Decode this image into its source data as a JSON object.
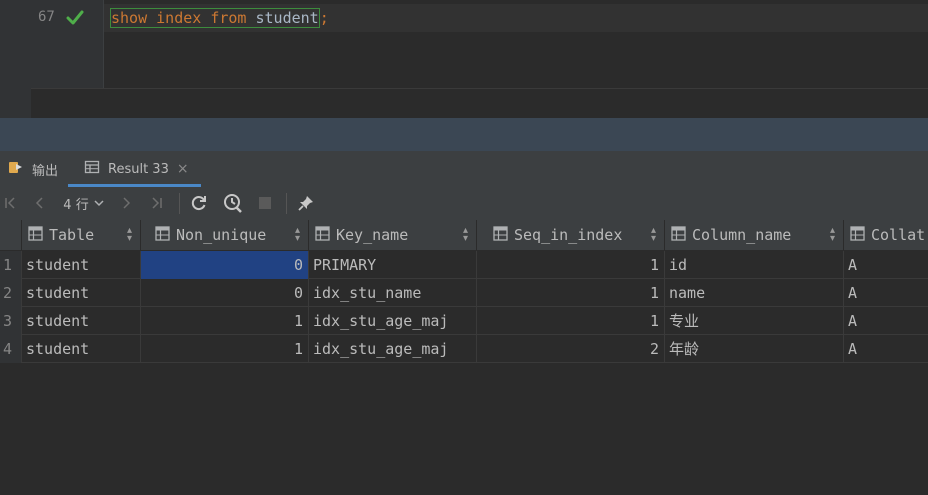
{
  "editor": {
    "line_number": "67",
    "code": {
      "kw1": "show",
      "kw2": "index",
      "kw3": "from",
      "ident": "student",
      "semicolon": ";"
    }
  },
  "tabs": [
    {
      "label": "输出",
      "icon": "output-icon"
    },
    {
      "label": "Result 33",
      "icon": "table-icon",
      "close": "×"
    }
  ],
  "toolbar": {
    "row_count": "4 行",
    "icons": [
      "first-page-icon",
      "prev-page-icon",
      "next-page-icon",
      "last-page-icon",
      "refresh-icon",
      "history-icon",
      "stop-icon",
      "pin-icon"
    ]
  },
  "grid": {
    "columns": [
      "Table",
      "Non_unique",
      "Key_name",
      "Seq_in_index",
      "Column_name",
      "Collat"
    ],
    "rows": [
      {
        "n": "1",
        "table": "student",
        "non_unique": "0",
        "key_name": "PRIMARY",
        "seq": "1",
        "column_name": "id",
        "collation": "A"
      },
      {
        "n": "2",
        "table": "student",
        "non_unique": "0",
        "key_name": "idx_stu_name",
        "seq": "1",
        "column_name": "name",
        "collation": "A"
      },
      {
        "n": "3",
        "table": "student",
        "non_unique": "1",
        "key_name": "idx_stu_age_maj",
        "seq": "1",
        "column_name": "专业",
        "collation": "A"
      },
      {
        "n": "4",
        "table": "student",
        "non_unique": "1",
        "key_name": "idx_stu_age_maj",
        "seq": "2",
        "column_name": "年龄",
        "collation": "A"
      }
    ]
  },
  "colors": {
    "accent": "#4a88c7",
    "selection": "#214283",
    "keyword": "#cc7832",
    "check": "#4fae4a"
  }
}
